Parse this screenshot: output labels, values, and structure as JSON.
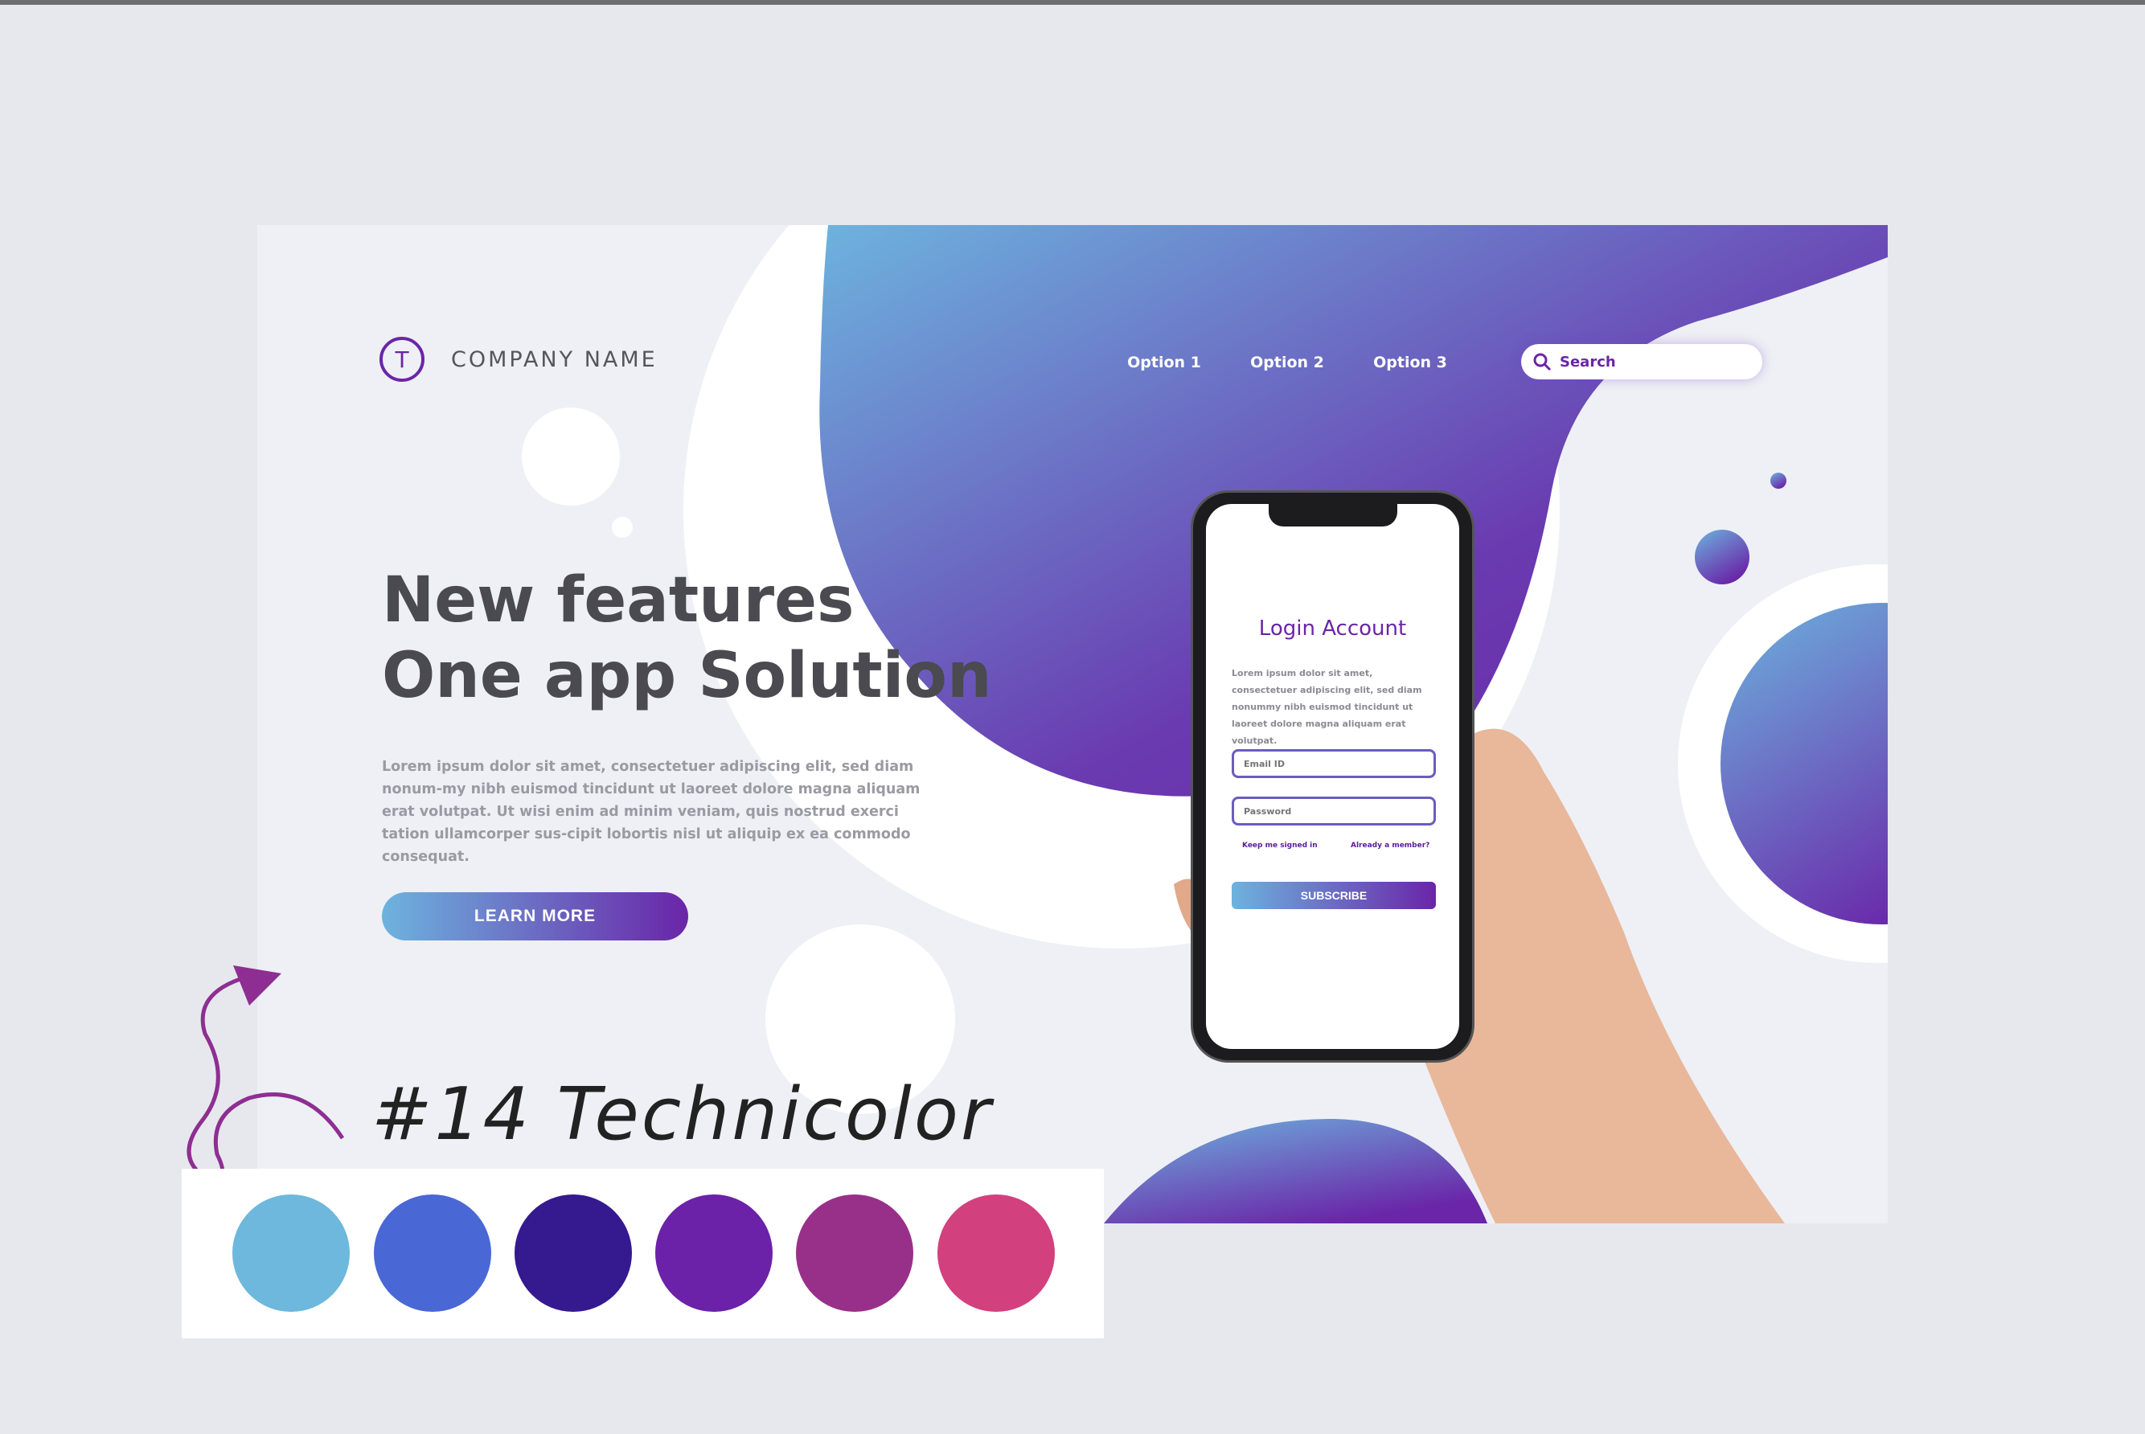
{
  "header": {
    "logo_letter": "T",
    "company_name": "COMPANY NAME",
    "nav": [
      "Option 1",
      "Option 2",
      "Option 3"
    ],
    "search_placeholder": "Search"
  },
  "hero": {
    "headline_line1": "New features",
    "headline_line2": "One app Solution",
    "paragraph": "Lorem ipsum dolor sit amet, consectetuer adipiscing elit, sed diam nonum-my nibh euismod tincidunt ut laoreet dolore magna aliquam erat volutpat. Ut wisi enim ad minim veniam, quis nostrud exerci tation ullamcorper sus-cipit lobortis nisl ut aliquip ex ea commodo consequat.",
    "button": "LEARN MORE"
  },
  "phone": {
    "title": "Login Account",
    "text": "Lorem ipsum dolor sit amet, consectetuer adipiscing elit, sed diam nonummy nibh euismod tincidunt ut laoreet dolore magna aliquam erat volutpat.",
    "email_placeholder": "Email ID",
    "password_placeholder": "Password",
    "keep_signed": "Keep me signed in",
    "already_member": "Already a member?",
    "subscribe": "SUBSCRIBE"
  },
  "palette": {
    "title": "#14 Technicolor",
    "colors": [
      "#6db8dc",
      "#4a67d6",
      "#35198f",
      "#6b21a8",
      "#98308a",
      "#d3407e"
    ]
  },
  "colors": {
    "gradient_start": "#6db3de",
    "gradient_end": "#6a25a8"
  }
}
